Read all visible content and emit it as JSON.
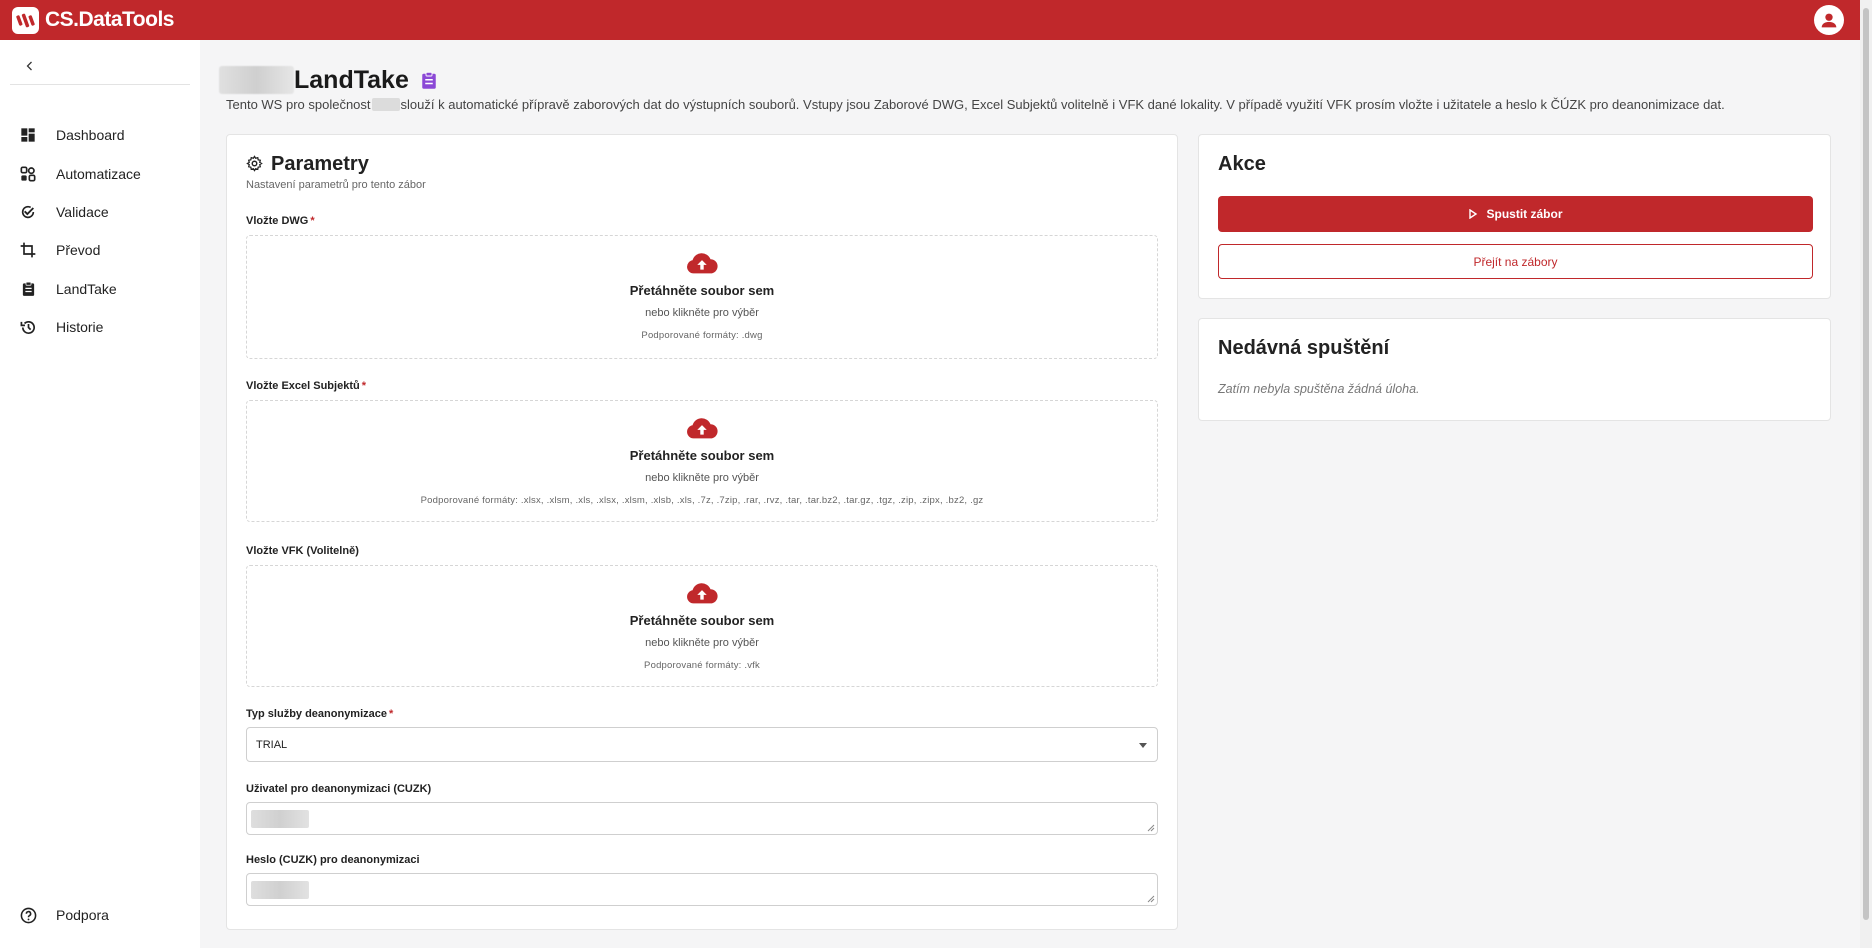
{
  "app": {
    "brand": "CS.DataTools",
    "brand_color": "#c0282b"
  },
  "topbar": {
    "logo_icon": "datatools-logo-icon",
    "user_icon": "account-circle-icon"
  },
  "sidebar": {
    "collapse_icon": "chevron-left-icon",
    "items": [
      {
        "label": "Dashboard",
        "icon": "dashboard-icon"
      },
      {
        "label": "Automatizace",
        "icon": "automation-icon"
      },
      {
        "label": "Validace",
        "icon": "checklist-icon"
      },
      {
        "label": "Převod",
        "icon": "crop-icon"
      },
      {
        "label": "LandTake",
        "icon": "clipboard-icon"
      },
      {
        "label": "Historie",
        "icon": "history-icon"
      }
    ],
    "support": {
      "label": "Podpora",
      "icon": "help-circle-icon"
    }
  },
  "page": {
    "title": "LandTake",
    "title_icon": "clipboard-text-icon",
    "description_part1": "Tento WS pro společnost",
    "description_part2": "slouží k automatické přípravě zaborových dat do výstupních souborů. Vstupy jsou Zaborové DWG, Excel Subjektů volitelně i VFK dané lokality. V případě využití VFK prosím vložte i užitatele a heslo k ČÚZK pro deanonimizace dat."
  },
  "params": {
    "title": "Parametry",
    "title_icon": "gear-icon",
    "subtitle": "Nastavení parametrů pro tento zábor",
    "dwg": {
      "label": "Vložte DWG",
      "required": "*",
      "drop_title": "Přetáhněte soubor sem",
      "drop_sub": "nebo klikněte pro výběr",
      "formats": "Podporované formáty: .dwg"
    },
    "excel": {
      "label": "Vložte Excel Subjektů",
      "required": "*",
      "drop_title": "Přetáhněte soubor sem",
      "drop_sub": "nebo klikněte pro výběr",
      "formats": "Podporované formáty: .xlsx, .xlsm, .xls, .xlsx, .xlsm, .xlsb, .xls, .7z, .7zip, .rar, .rvz, .tar, .tar.bz2, .tar.gz, .tgz, .zip, .zipx, .bz2, .gz"
    },
    "vfk": {
      "label": "Vložte VFK (Volitelně)",
      "drop_title": "Přetáhněte soubor sem",
      "drop_sub": "nebo klikněte pro výběr",
      "formats": "Podporované formáty: .vfk"
    },
    "service_type": {
      "label": "Typ služby deanonymizace",
      "required": "*",
      "value": "TRIAL"
    },
    "user": {
      "label": "Uživatel pro deanonymizaci (CUZK)"
    },
    "password": {
      "label": "Heslo (CUZK) pro deanonymizaci"
    }
  },
  "actions": {
    "title": "Akce",
    "run_label": "Spustit zábor",
    "run_icon": "play-icon",
    "goto_label": "Přejít na zábory"
  },
  "recent": {
    "title": "Nedávná spuštění",
    "empty": "Zatím nebyla spuštěna žádná úloha."
  }
}
